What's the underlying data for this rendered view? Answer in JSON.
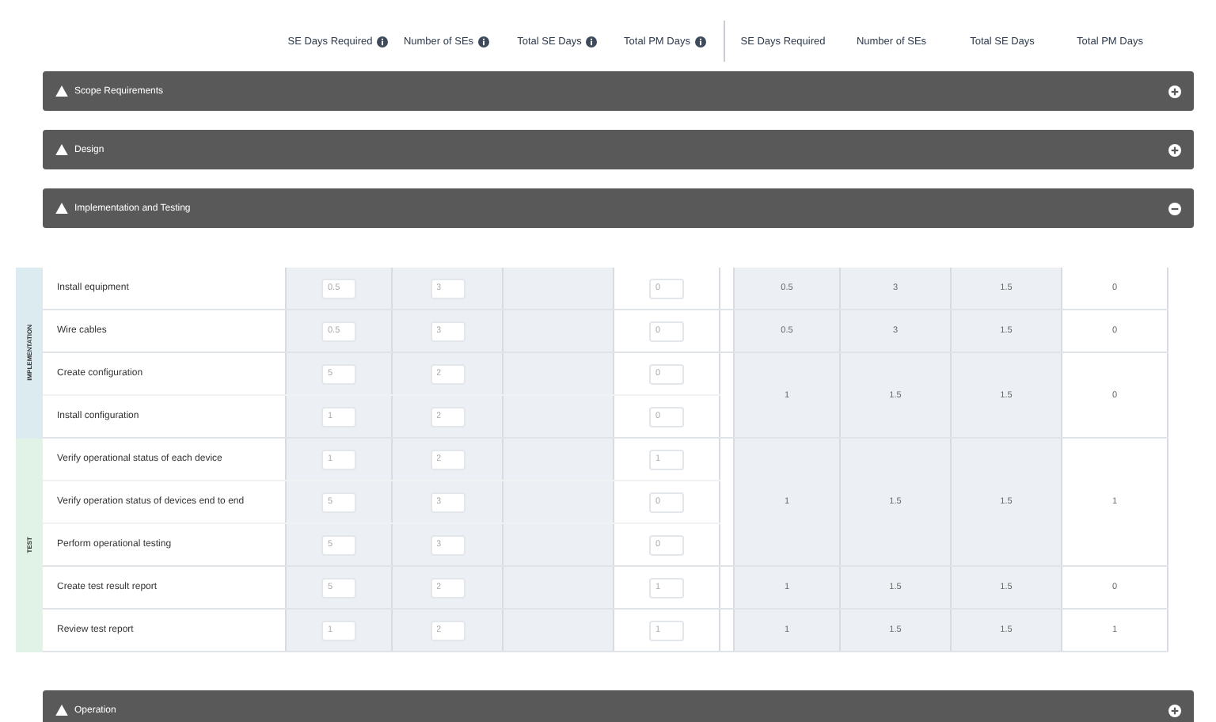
{
  "header": {
    "input_columns": [
      {
        "label": "SE Days Required",
        "info": true
      },
      {
        "label": "Number of SEs",
        "info": true
      },
      {
        "label": "Total SE Days",
        "info": true
      },
      {
        "label": "Total PM Days",
        "info": true
      }
    ],
    "result_columns": [
      "SE Days Required",
      "Number of SEs",
      "Total SE Days",
      "Total PM Days"
    ]
  },
  "sections_before": [
    {
      "title": "Scope Requirements",
      "expanded": false
    },
    {
      "title": "Design",
      "expanded": false
    },
    {
      "title": "Implementation and Testing",
      "expanded": true
    }
  ],
  "groups": [
    {
      "label": "IMPLEMENTATION",
      "color": "#dcebf0",
      "blocks": [
        {
          "results": [
            "0.5",
            "3",
            "1.5",
            "0"
          ],
          "tasks": [
            {
              "name": "Install equipment",
              "inputs": [
                "0.5",
                "3",
                "0"
              ]
            }
          ]
        },
        {
          "results": [
            "0.5",
            "3",
            "1.5",
            "0"
          ],
          "tasks": [
            {
              "name": "Wire cables",
              "inputs": [
                "0.5",
                "3",
                "0"
              ]
            }
          ]
        },
        {
          "results": [
            "1",
            "1.5",
            "1.5",
            "0"
          ],
          "tasks": [
            {
              "name": "Create configuration",
              "inputs": [
                "5",
                "2",
                "0"
              ]
            },
            {
              "name": "Install configuration",
              "inputs": [
                "1",
                "2",
                "0"
              ]
            }
          ]
        }
      ]
    },
    {
      "label": "TEST",
      "color": "#e0f3e6",
      "blocks": [
        {
          "results": [
            "1",
            "1.5",
            "1.5",
            "1"
          ],
          "tasks": [
            {
              "name": "Verify operational status of each device",
              "inputs": [
                "1",
                "2",
                "1"
              ]
            },
            {
              "name": "Verify operation status of devices end to end",
              "inputs": [
                "5",
                "3",
                "0"
              ]
            },
            {
              "name": "Perform operational testing",
              "inputs": [
                "5",
                "3",
                "0"
              ]
            }
          ]
        },
        {
          "results": [
            "1",
            "1.5",
            "1.5",
            "0"
          ],
          "tasks": [
            {
              "name": "Create test result report",
              "inputs": [
                "5",
                "2",
                "1"
              ]
            }
          ]
        },
        {
          "results": [
            "1",
            "1.5",
            "1.5",
            "1"
          ],
          "tasks": [
            {
              "name": "Review test report",
              "inputs": [
                "1",
                "2",
                "1"
              ]
            }
          ]
        }
      ]
    }
  ],
  "sections_after": [
    {
      "title": "Operation",
      "expanded": false
    }
  ]
}
